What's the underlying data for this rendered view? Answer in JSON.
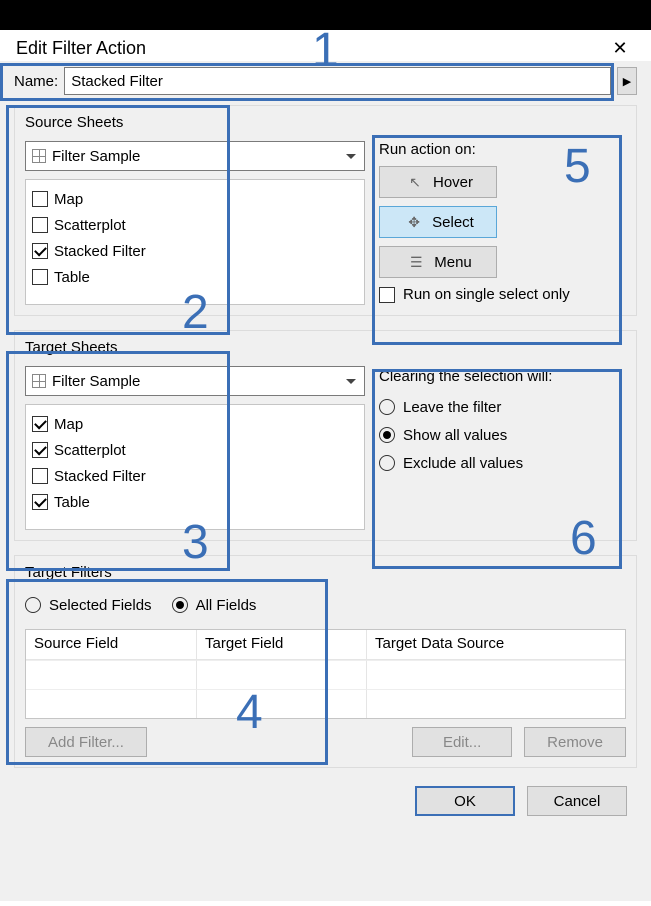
{
  "header": {
    "title": "Edit Filter Action"
  },
  "name": {
    "label": "Name:",
    "value": "Stacked Filter"
  },
  "source": {
    "group_title": "Source Sheets",
    "dropdown_value": "Filter Sample",
    "items": [
      {
        "label": "Map",
        "checked": false
      },
      {
        "label": "Scatterplot",
        "checked": false
      },
      {
        "label": "Stacked Filter",
        "checked": true
      },
      {
        "label": "Table",
        "checked": false
      }
    ]
  },
  "run_action": {
    "label": "Run action on:",
    "buttons": {
      "hover": "Hover",
      "select": "Select",
      "menu": "Menu"
    },
    "selected": "select",
    "single_select_label": "Run on single select only",
    "single_select_checked": false
  },
  "target": {
    "group_title": "Target Sheets",
    "dropdown_value": "Filter Sample",
    "items": [
      {
        "label": "Map",
        "checked": true
      },
      {
        "label": "Scatterplot",
        "checked": true
      },
      {
        "label": "Stacked Filter",
        "checked": false
      },
      {
        "label": "Table",
        "checked": true
      }
    ]
  },
  "clearing": {
    "label": "Clearing the selection will:",
    "options": {
      "leave": "Leave the filter",
      "showall": "Show all values",
      "exclude": "Exclude all values"
    },
    "selected": "showall"
  },
  "target_filters": {
    "group_title": "Target Filters",
    "radio_selected_fields": "Selected Fields",
    "radio_all_fields": "All Fields",
    "radio_selected": "all",
    "columns": {
      "source_field": "Source Field",
      "target_field": "Target Field",
      "target_ds": "Target Data Source"
    },
    "buttons": {
      "add": "Add Filter...",
      "edit": "Edit...",
      "remove": "Remove"
    }
  },
  "footer": {
    "ok": "OK",
    "cancel": "Cancel"
  },
  "callouts": {
    "1": "1",
    "2": "2",
    "3": "3",
    "4": "4",
    "5": "5",
    "6": "6"
  }
}
